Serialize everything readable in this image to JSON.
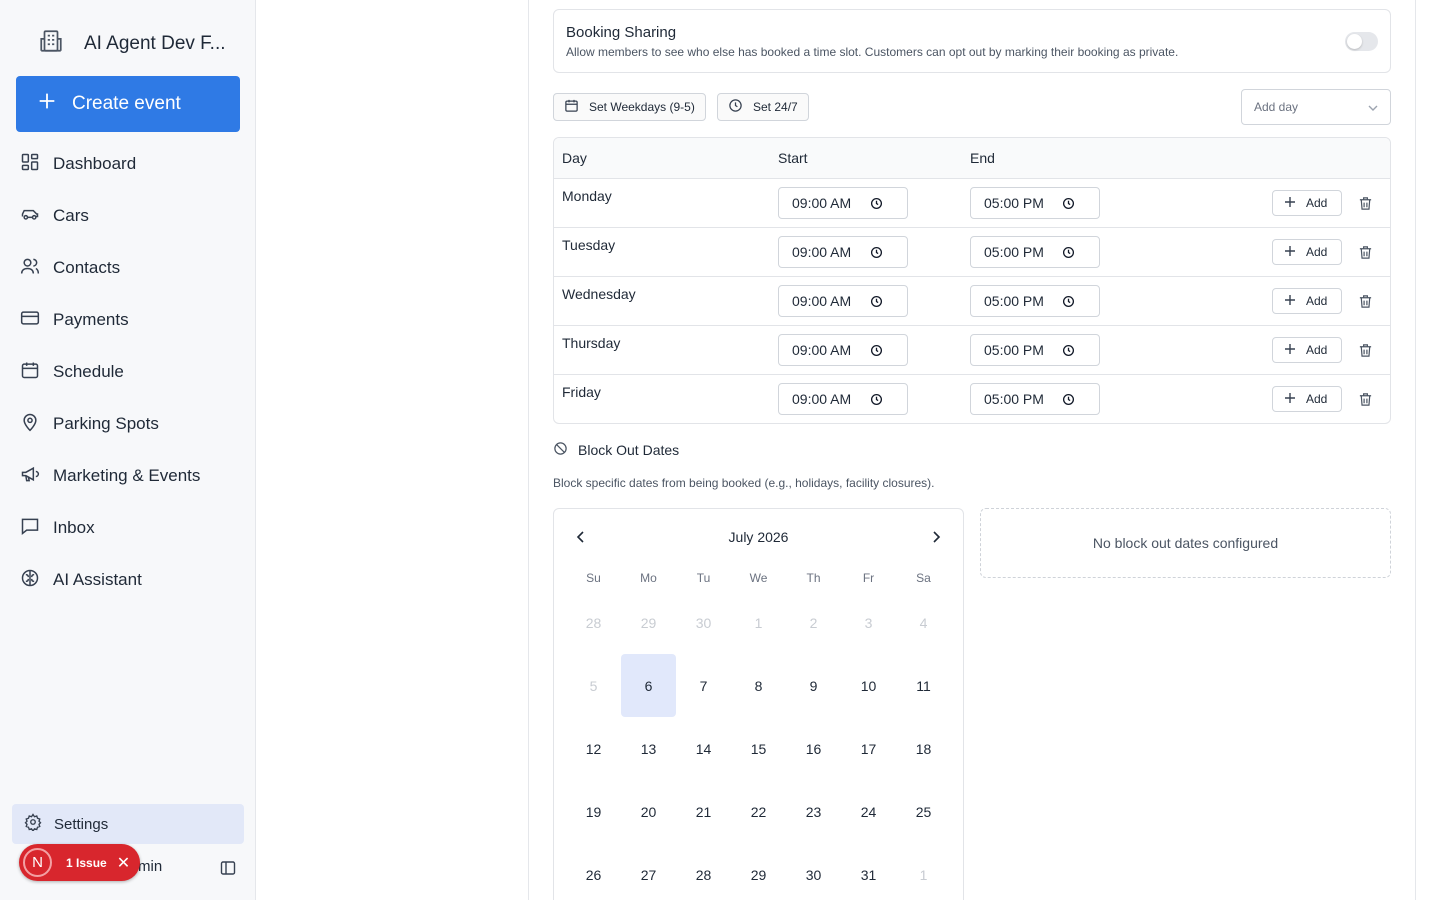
{
  "sidebar": {
    "org_name": "AI Agent Dev F...",
    "create_label": "Create event",
    "items": [
      {
        "label": "Dashboard",
        "icon": "dashboard-icon"
      },
      {
        "label": "Cars",
        "icon": "car-icon"
      },
      {
        "label": "Contacts",
        "icon": "users-icon"
      },
      {
        "label": "Payments",
        "icon": "credit-card-icon"
      },
      {
        "label": "Schedule",
        "icon": "calendar-icon"
      },
      {
        "label": "Parking Spots",
        "icon": "map-pin-icon"
      },
      {
        "label": "Marketing & Events",
        "icon": "megaphone-icon"
      },
      {
        "label": "Inbox",
        "icon": "message-icon"
      },
      {
        "label": "AI Assistant",
        "icon": "brain-icon"
      }
    ],
    "settings_label": "Settings",
    "user_label_tail": "min",
    "issue": {
      "avatar": "N",
      "label": "1 Issue"
    }
  },
  "booking_sharing": {
    "title": "Booking Sharing",
    "description": "Allow members to see who else has booked a time slot. Customers can opt out by marking their booking as private.",
    "enabled": false
  },
  "presets": {
    "weekdays": "Set Weekdays (9-5)",
    "all": "Set 24/7"
  },
  "add_day_placeholder": "Add day",
  "hours_table": {
    "headers": {
      "day": "Day",
      "start": "Start",
      "end": "End"
    },
    "add_label": "Add",
    "rows": [
      {
        "day": "Monday",
        "start": "09:00 AM",
        "end": "05:00 PM"
      },
      {
        "day": "Tuesday",
        "start": "09:00 AM",
        "end": "05:00 PM"
      },
      {
        "day": "Wednesday",
        "start": "09:00 AM",
        "end": "05:00 PM"
      },
      {
        "day": "Thursday",
        "start": "09:00 AM",
        "end": "05:00 PM"
      },
      {
        "day": "Friday",
        "start": "09:00 AM",
        "end": "05:00 PM"
      }
    ]
  },
  "block_out": {
    "title": "Block Out Dates",
    "description": "Block specific dates from being booked (e.g., holidays, facility closures).",
    "empty_text": "No block out dates configured"
  },
  "calendar": {
    "month_label": "July 2026",
    "weekdays": [
      "Su",
      "Mo",
      "Tu",
      "We",
      "Th",
      "Fr",
      "Sa"
    ],
    "selected_day": "6",
    "days": [
      {
        "d": "28",
        "out": true
      },
      {
        "d": "29",
        "out": true
      },
      {
        "d": "30",
        "out": true
      },
      {
        "d": "1",
        "out": true
      },
      {
        "d": "2",
        "out": true
      },
      {
        "d": "3",
        "out": true
      },
      {
        "d": "4",
        "out": true
      },
      {
        "d": "5",
        "out": true
      },
      {
        "d": "6",
        "out": false
      },
      {
        "d": "7",
        "out": false
      },
      {
        "d": "8",
        "out": false
      },
      {
        "d": "9",
        "out": false
      },
      {
        "d": "10",
        "out": false
      },
      {
        "d": "11",
        "out": false
      },
      {
        "d": "12",
        "out": false
      },
      {
        "d": "13",
        "out": false
      },
      {
        "d": "14",
        "out": false
      },
      {
        "d": "15",
        "out": false
      },
      {
        "d": "16",
        "out": false
      },
      {
        "d": "17",
        "out": false
      },
      {
        "d": "18",
        "out": false
      },
      {
        "d": "19",
        "out": false
      },
      {
        "d": "20",
        "out": false
      },
      {
        "d": "21",
        "out": false
      },
      {
        "d": "22",
        "out": false
      },
      {
        "d": "23",
        "out": false
      },
      {
        "d": "24",
        "out": false
      },
      {
        "d": "25",
        "out": false
      },
      {
        "d": "26",
        "out": false
      },
      {
        "d": "27",
        "out": false
      },
      {
        "d": "28",
        "out": false
      },
      {
        "d": "29",
        "out": false
      },
      {
        "d": "30",
        "out": false
      },
      {
        "d": "31",
        "out": false
      },
      {
        "d": "1",
        "out": true
      }
    ]
  },
  "colors": {
    "primary": "#2f7ae5",
    "selected": "#e1e8fb",
    "issue": "#d8262d",
    "sidebar_bg": "#f7f8fa"
  }
}
